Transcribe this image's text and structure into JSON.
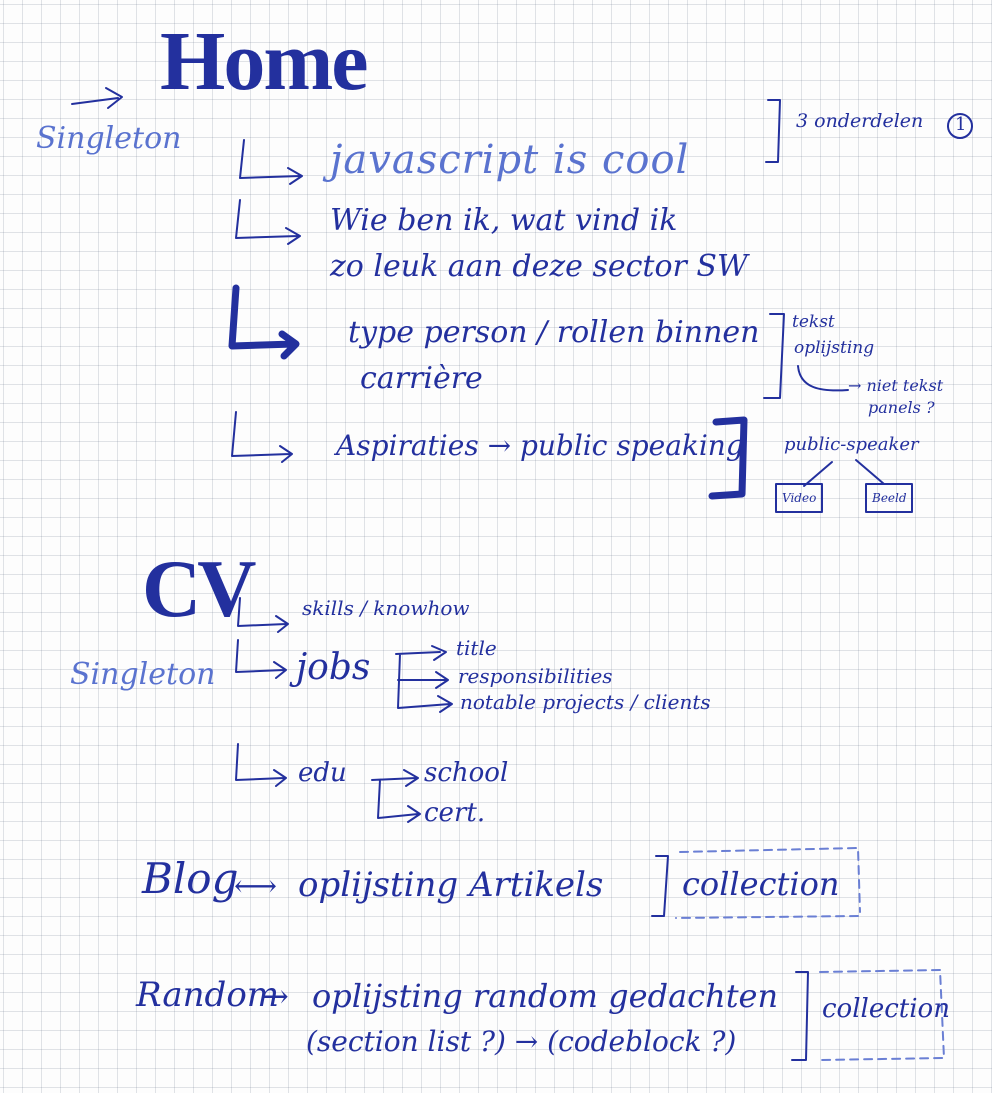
{
  "home": {
    "title": "Home",
    "label": "Singleton",
    "items": [
      {
        "line1": "javascript is cool",
        "line2": ""
      },
      {
        "line1": "Wie ben ik, wat vind ik",
        "line2": "zo leuk aan deze sector SW"
      },
      {
        "line1": "type person / rollen binnen",
        "line2": "carrière"
      },
      {
        "line1": "Aspiraties → public speaking",
        "line2": ""
      }
    ],
    "note_count": "3 onderdelen",
    "note_number": "1",
    "note_panels": [
      "tekst",
      "oplijsting",
      "→ niet tekst",
      "panels ?"
    ],
    "public_speaking": {
      "title": "public-speaker",
      "boxes": [
        "Video",
        "Beeld"
      ]
    }
  },
  "cv": {
    "title": "CV",
    "label": "Singleton",
    "skills": "skills / knowhow",
    "jobs": "jobs",
    "job_fields": [
      "title",
      "responsibilities",
      "notable projects / clients"
    ],
    "edu": "edu",
    "edu_fields": [
      "school",
      "cert."
    ]
  },
  "blog": {
    "title": "Blog",
    "arrow": "⟷",
    "text": "oplijsting Artikels",
    "tag": "collection"
  },
  "random": {
    "title": "Random",
    "arrow": "→",
    "line1": "oplijsting random gedachten",
    "line2": "(section list ?) → (codeblock ?)",
    "tag": "collection"
  }
}
